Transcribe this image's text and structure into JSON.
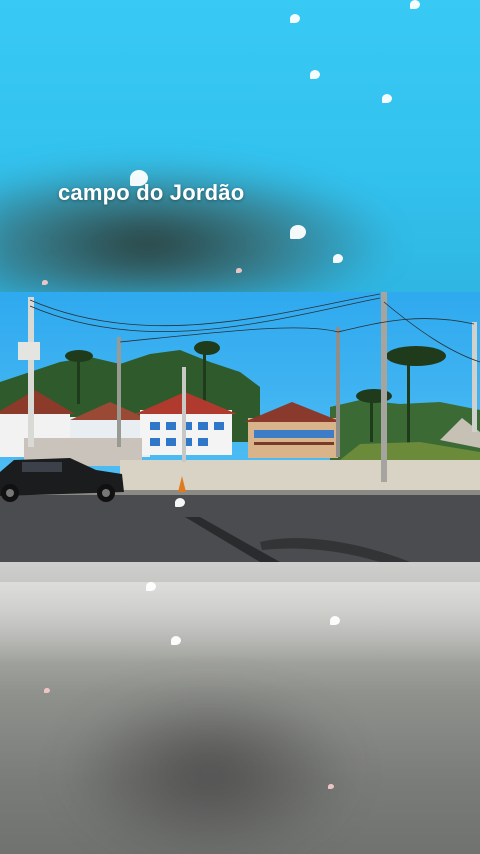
{
  "overlay": {
    "title": "campo do Jordão"
  },
  "colors": {
    "sky": "#34c6f0",
    "road": "#4a4c50",
    "title_text": "#ffffff"
  },
  "scene": {
    "description_icon": "street-photo"
  }
}
